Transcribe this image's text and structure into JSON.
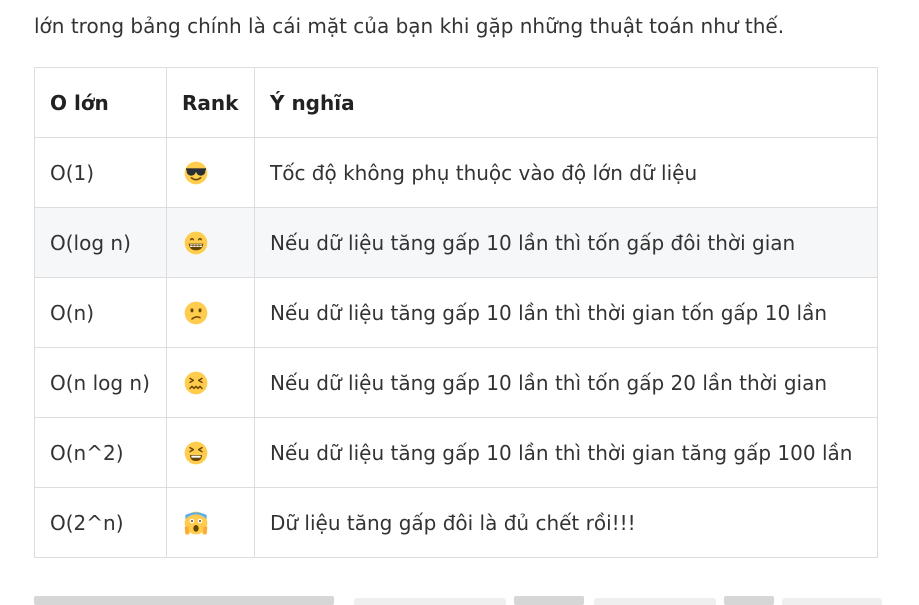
{
  "intro_text": "lớn trong bảng chính là cái mặt của bạn khi gặp những thuật toán như thế.",
  "table": {
    "headers": [
      "O lớn",
      "Rank",
      "Ý nghĩa"
    ],
    "rows": [
      {
        "complexity": "O(1)",
        "rank_icon": "cool-sunglasses-face-icon",
        "meaning": "Tốc độ không phụ thuộc vào độ lớn dữ liệu"
      },
      {
        "complexity": "O(log n)",
        "rank_icon": "grinning-face-icon",
        "meaning": "Nếu dữ liệu tăng gấp 10 lần thì tốn gấp đôi thời gian"
      },
      {
        "complexity": "O(n)",
        "rank_icon": "confused-face-icon",
        "meaning": "Nếu dữ liệu tăng gấp 10 lần thì thời gian tốn gấp 10 lần"
      },
      {
        "complexity": "O(n log n)",
        "rank_icon": "confounded-face-icon",
        "meaning": "Nếu dữ liệu tăng gấp 10 lần thì tốn gấp 20 lần thời gian"
      },
      {
        "complexity": "O(n^2)",
        "rank_icon": "tired-face-icon",
        "meaning": "Nếu dữ liệu tăng gấp 10 lần thì thời gian tăng gấp 100 lần"
      },
      {
        "complexity": "O(2^n)",
        "rank_icon": "screaming-face-icon",
        "meaning": "Dữ liệu tăng gấp đôi là đủ chết rồi!!!"
      }
    ]
  },
  "colors": {
    "text": "#333333",
    "border": "#dddddd",
    "alt_row": "#f6f7f9",
    "emoji_face": "#ffcc4d",
    "emoji_feature": "#664500"
  }
}
